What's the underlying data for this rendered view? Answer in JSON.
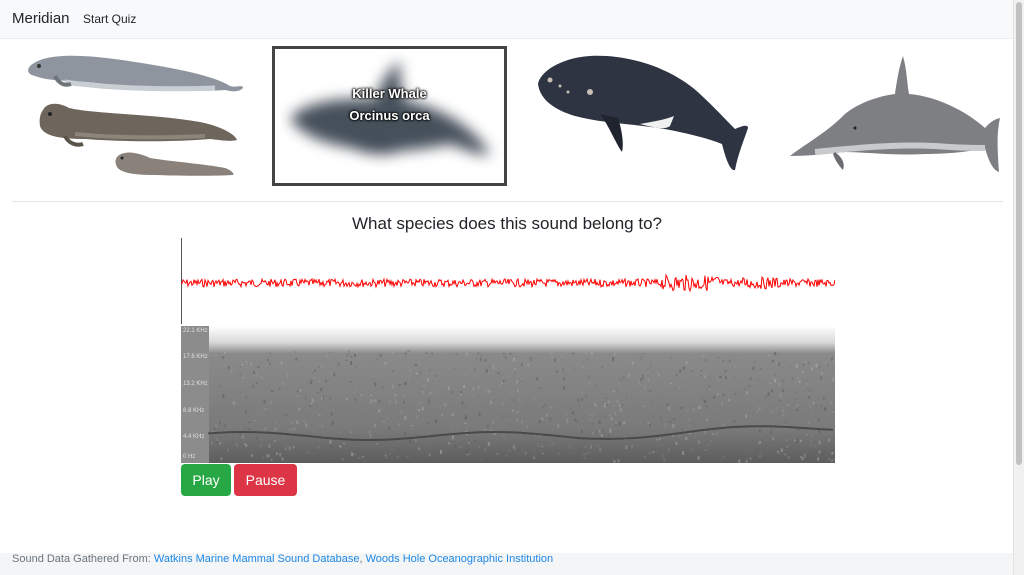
{
  "navbar": {
    "brand": "Meridian",
    "link_start_quiz": "Start Quiz"
  },
  "species_cards": [
    {
      "icon": "seal-group-illustration"
    },
    {
      "icon": "killer-whale-illustration",
      "name": "Killer Whale",
      "scientific": "Orcinus orca",
      "selected": true
    },
    {
      "icon": "right-whale-illustration"
    },
    {
      "icon": "dolphin-illustration"
    }
  ],
  "question": "What species does this sound belong to?",
  "spectrogram": {
    "frequency_labels": [
      "22.1 KHz",
      "17.6 KHz",
      "13.2 KHz",
      "8.8 KHz",
      "4.4 KHz",
      "0 Hz"
    ]
  },
  "controls": {
    "play_label": "Play",
    "pause_label": "Pause"
  },
  "footer": {
    "prefix": "Sound Data Gathered From:",
    "link1": "Watkins Marine Mammal Sound Database",
    "separator": ", ",
    "link2": "Woods Hole Oceanographic Institution"
  },
  "colors": {
    "play": "#28a745",
    "pause": "#dc3545",
    "waveform": "#ff0000",
    "link": "#1e88e5"
  }
}
